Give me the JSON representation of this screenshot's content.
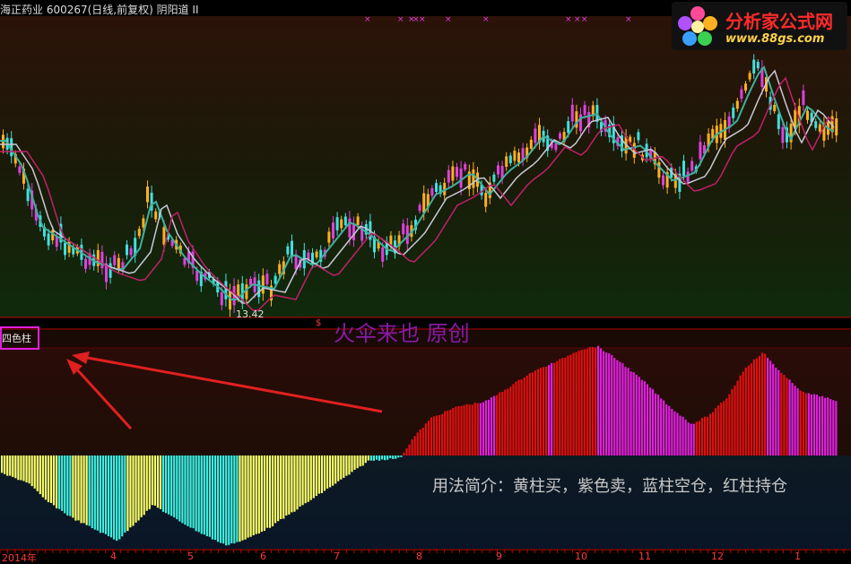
{
  "header": {
    "title": "海正药业 600267(日线,前复权) 阴阳道 II"
  },
  "watermark": {
    "site_name": "分析家公式网",
    "url": "www.88gs.com"
  },
  "main_chart": {
    "low_marker": "13.42",
    "dollar_mark": "$"
  },
  "indicator_panel": {
    "name": "四色柱",
    "author_note": "火伞来也 原创",
    "usage_text": "用法简介：黄柱买，紫色卖，蓝柱空仓，红柱持仓"
  },
  "x_axis": {
    "labels": [
      "2014年",
      "4",
      "5",
      "6",
      "7",
      "8",
      "9",
      "10",
      "11",
      "12",
      "1"
    ]
  },
  "colors": {
    "bar_yellow": "#ffff66",
    "bar_cyan": "#40f0e0",
    "bar_magenta": "#e020e0",
    "bar_red": "#e01010",
    "annotation_arrow": "#e02020"
  },
  "chart_data": {
    "type": "bar",
    "title": "四色柱",
    "x": [
      "2014年",
      "4",
      "5",
      "6",
      "7",
      "8",
      "9",
      "10",
      "11",
      "12",
      "1"
    ],
    "series": [
      {
        "name": "黄柱",
        "meaning": "买"
      },
      {
        "name": "紫色",
        "meaning": "卖"
      },
      {
        "name": "蓝柱",
        "meaning": "空仓"
      },
      {
        "name": "红柱",
        "meaning": "持仓"
      }
    ]
  }
}
